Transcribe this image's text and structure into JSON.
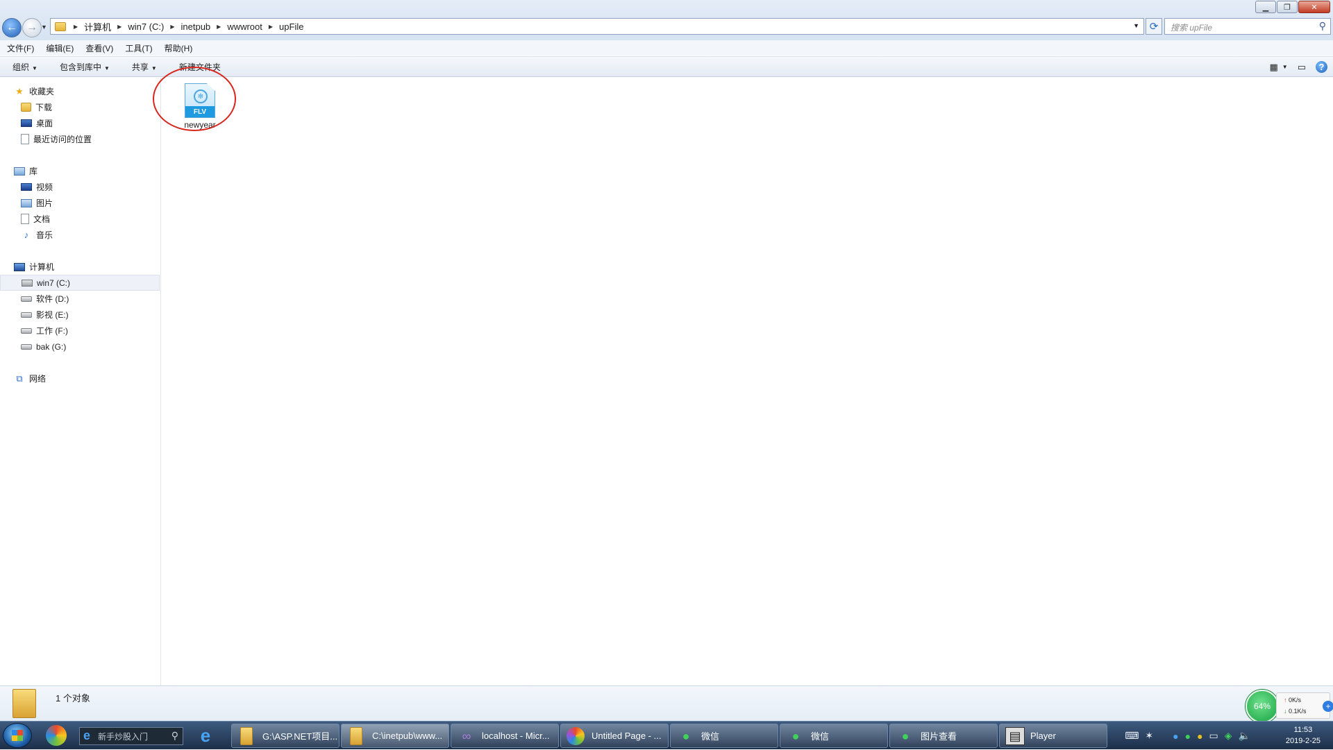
{
  "addressbar": {
    "path": [
      "计算机",
      "win7 (C:)",
      "inetpub",
      "wwwroot",
      "upFile"
    ],
    "search_placeholder": "搜索 upFile"
  },
  "menu": [
    "文件(F)",
    "编辑(E)",
    "查看(V)",
    "工具(T)",
    "帮助(H)"
  ],
  "toolbar": {
    "organize": "组织",
    "include_library": "包含到库中",
    "share": "共享",
    "new_folder": "新建文件夹"
  },
  "sidebar": {
    "favorites_label": "收藏夹",
    "favorites": [
      "下载",
      "桌面",
      "最近访问的位置"
    ],
    "libraries_label": "库",
    "libraries": [
      "视频",
      "图片",
      "文档",
      "音乐"
    ],
    "computer_label": "计算机",
    "drives": [
      "win7 (C:)",
      "软件 (D:)",
      "影视 (E:)",
      "工作 (F:)",
      "bak (G:)"
    ],
    "selected_drive": "win7 (C:)",
    "network_label": "网络"
  },
  "content": {
    "file": {
      "name": "newyear",
      "type": "FLV"
    }
  },
  "status": {
    "count": "1 个对象"
  },
  "netmeter": {
    "percent": "64%",
    "up": "0K/s",
    "down": "0.1K/s"
  },
  "taskbar": {
    "search_text": "新手炒股入门",
    "tasks": [
      {
        "label": "G:\\ASP.NET项目...",
        "icon": "folder-icon"
      },
      {
        "label": "C:\\inetpub\\www...",
        "icon": "folder-icon"
      },
      {
        "label": "localhost - Micr...",
        "icon": "visual-studio-icon"
      },
      {
        "label": "Untitled Page - ...",
        "icon": "browser-color-icon"
      },
      {
        "label": "微信",
        "icon": "wechat-icon"
      },
      {
        "label": "微信",
        "icon": "wechat-icon"
      },
      {
        "label": "图片查看",
        "icon": "wechat-icon"
      },
      {
        "label": "Player",
        "icon": "player-icon"
      }
    ],
    "time": "11:53",
    "date": "2019-2-25"
  }
}
